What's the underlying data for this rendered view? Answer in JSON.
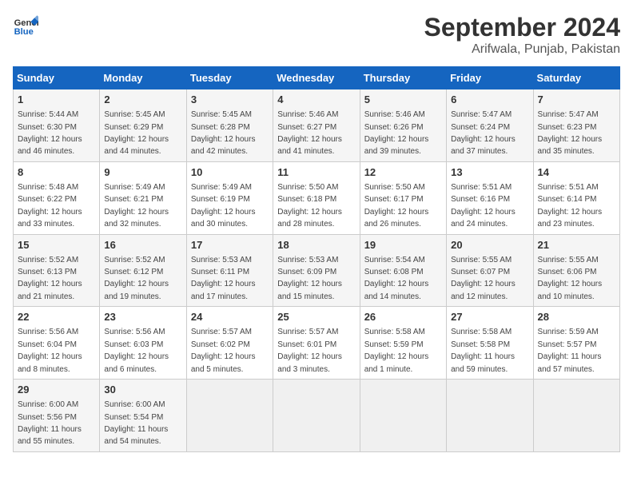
{
  "header": {
    "logo_line1": "General",
    "logo_line2": "Blue",
    "title": "September 2024",
    "subtitle": "Arifwala, Punjab, Pakistan"
  },
  "calendar": {
    "days_of_week": [
      "Sunday",
      "Monday",
      "Tuesday",
      "Wednesday",
      "Thursday",
      "Friday",
      "Saturday"
    ],
    "weeks": [
      [
        null,
        {
          "day": "2",
          "sunrise": "Sunrise: 5:45 AM",
          "sunset": "Sunset: 6:29 PM",
          "daylight": "Daylight: 12 hours and 44 minutes."
        },
        {
          "day": "3",
          "sunrise": "Sunrise: 5:45 AM",
          "sunset": "Sunset: 6:28 PM",
          "daylight": "Daylight: 12 hours and 42 minutes."
        },
        {
          "day": "4",
          "sunrise": "Sunrise: 5:46 AM",
          "sunset": "Sunset: 6:27 PM",
          "daylight": "Daylight: 12 hours and 41 minutes."
        },
        {
          "day": "5",
          "sunrise": "Sunrise: 5:46 AM",
          "sunset": "Sunset: 6:26 PM",
          "daylight": "Daylight: 12 hours and 39 minutes."
        },
        {
          "day": "6",
          "sunrise": "Sunrise: 5:47 AM",
          "sunset": "Sunset: 6:24 PM",
          "daylight": "Daylight: 12 hours and 37 minutes."
        },
        {
          "day": "7",
          "sunrise": "Sunrise: 5:47 AM",
          "sunset": "Sunset: 6:23 PM",
          "daylight": "Daylight: 12 hours and 35 minutes."
        }
      ],
      [
        {
          "day": "1",
          "sunrise": "Sunrise: 5:44 AM",
          "sunset": "Sunset: 6:30 PM",
          "daylight": "Daylight: 12 hours and 46 minutes."
        },
        {
          "day": "9",
          "sunrise": "Sunrise: 5:49 AM",
          "sunset": "Sunset: 6:21 PM",
          "daylight": "Daylight: 12 hours and 32 minutes."
        },
        {
          "day": "10",
          "sunrise": "Sunrise: 5:49 AM",
          "sunset": "Sunset: 6:19 PM",
          "daylight": "Daylight: 12 hours and 30 minutes."
        },
        {
          "day": "11",
          "sunrise": "Sunrise: 5:50 AM",
          "sunset": "Sunset: 6:18 PM",
          "daylight": "Daylight: 12 hours and 28 minutes."
        },
        {
          "day": "12",
          "sunrise": "Sunrise: 5:50 AM",
          "sunset": "Sunset: 6:17 PM",
          "daylight": "Daylight: 12 hours and 26 minutes."
        },
        {
          "day": "13",
          "sunrise": "Sunrise: 5:51 AM",
          "sunset": "Sunset: 6:16 PM",
          "daylight": "Daylight: 12 hours and 24 minutes."
        },
        {
          "day": "14",
          "sunrise": "Sunrise: 5:51 AM",
          "sunset": "Sunset: 6:14 PM",
          "daylight": "Daylight: 12 hours and 23 minutes."
        }
      ],
      [
        {
          "day": "8",
          "sunrise": "Sunrise: 5:48 AM",
          "sunset": "Sunset: 6:22 PM",
          "daylight": "Daylight: 12 hours and 33 minutes."
        },
        {
          "day": "16",
          "sunrise": "Sunrise: 5:52 AM",
          "sunset": "Sunset: 6:12 PM",
          "daylight": "Daylight: 12 hours and 19 minutes."
        },
        {
          "day": "17",
          "sunrise": "Sunrise: 5:53 AM",
          "sunset": "Sunset: 6:11 PM",
          "daylight": "Daylight: 12 hours and 17 minutes."
        },
        {
          "day": "18",
          "sunrise": "Sunrise: 5:53 AM",
          "sunset": "Sunset: 6:09 PM",
          "daylight": "Daylight: 12 hours and 15 minutes."
        },
        {
          "day": "19",
          "sunrise": "Sunrise: 5:54 AM",
          "sunset": "Sunset: 6:08 PM",
          "daylight": "Daylight: 12 hours and 14 minutes."
        },
        {
          "day": "20",
          "sunrise": "Sunrise: 5:55 AM",
          "sunset": "Sunset: 6:07 PM",
          "daylight": "Daylight: 12 hours and 12 minutes."
        },
        {
          "day": "21",
          "sunrise": "Sunrise: 5:55 AM",
          "sunset": "Sunset: 6:06 PM",
          "daylight": "Daylight: 12 hours and 10 minutes."
        }
      ],
      [
        {
          "day": "15",
          "sunrise": "Sunrise: 5:52 AM",
          "sunset": "Sunset: 6:13 PM",
          "daylight": "Daylight: 12 hours and 21 minutes."
        },
        {
          "day": "23",
          "sunrise": "Sunrise: 5:56 AM",
          "sunset": "Sunset: 6:03 PM",
          "daylight": "Daylight: 12 hours and 6 minutes."
        },
        {
          "day": "24",
          "sunrise": "Sunrise: 5:57 AM",
          "sunset": "Sunset: 6:02 PM",
          "daylight": "Daylight: 12 hours and 5 minutes."
        },
        {
          "day": "25",
          "sunrise": "Sunrise: 5:57 AM",
          "sunset": "Sunset: 6:01 PM",
          "daylight": "Daylight: 12 hours and 3 minutes."
        },
        {
          "day": "26",
          "sunrise": "Sunrise: 5:58 AM",
          "sunset": "Sunset: 5:59 PM",
          "daylight": "Daylight: 12 hours and 1 minute."
        },
        {
          "day": "27",
          "sunrise": "Sunrise: 5:58 AM",
          "sunset": "Sunset: 5:58 PM",
          "daylight": "Daylight: 11 hours and 59 minutes."
        },
        {
          "day": "28",
          "sunrise": "Sunrise: 5:59 AM",
          "sunset": "Sunset: 5:57 PM",
          "daylight": "Daylight: 11 hours and 57 minutes."
        }
      ],
      [
        {
          "day": "22",
          "sunrise": "Sunrise: 5:56 AM",
          "sunset": "Sunset: 6:04 PM",
          "daylight": "Daylight: 12 hours and 8 minutes."
        },
        {
          "day": "30",
          "sunrise": "Sunrise: 6:00 AM",
          "sunset": "Sunset: 5:54 PM",
          "daylight": "Daylight: 11 hours and 54 minutes."
        },
        null,
        null,
        null,
        null,
        null
      ],
      [
        {
          "day": "29",
          "sunrise": "Sunrise: 6:00 AM",
          "sunset": "Sunset: 5:56 PM",
          "daylight": "Daylight: 11 hours and 55 minutes."
        },
        null,
        null,
        null,
        null,
        null,
        null
      ]
    ]
  }
}
